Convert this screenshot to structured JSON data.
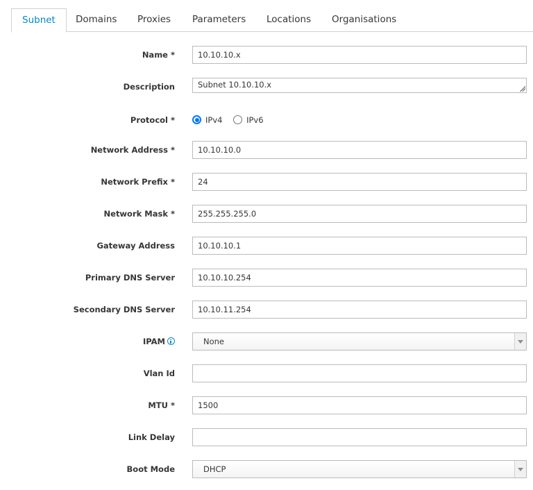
{
  "tabs": [
    {
      "label": "Subnet",
      "active": true
    },
    {
      "label": "Domains",
      "active": false
    },
    {
      "label": "Proxies",
      "active": false
    },
    {
      "label": "Parameters",
      "active": false
    },
    {
      "label": "Locations",
      "active": false
    },
    {
      "label": "Organisations",
      "active": false
    }
  ],
  "form": {
    "name": {
      "label": "Name *",
      "value": "10.10.10.x"
    },
    "description": {
      "label": "Description",
      "value": "Subnet 10.10.10.x"
    },
    "protocol": {
      "label": "Protocol *",
      "options": [
        "IPv4",
        "IPv6"
      ],
      "selected": "IPv4"
    },
    "network_address": {
      "label": "Network Address *",
      "value": "10.10.10.0"
    },
    "network_prefix": {
      "label": "Network Prefix *",
      "value": "24"
    },
    "network_mask": {
      "label": "Network Mask *",
      "value": "255.255.255.0"
    },
    "gateway_address": {
      "label": "Gateway Address",
      "value": "10.10.10.1"
    },
    "primary_dns": {
      "label": "Primary DNS Server",
      "value": "10.10.10.254"
    },
    "secondary_dns": {
      "label": "Secondary DNS Server",
      "value": "10.10.11.254"
    },
    "ipam": {
      "label": "IPAM",
      "value": "None",
      "info_icon": "info-circle-icon"
    },
    "vlan_id": {
      "label": "Vlan Id",
      "value": ""
    },
    "mtu": {
      "label": "MTU *",
      "value": "1500"
    },
    "link_delay": {
      "label": "Link Delay",
      "value": ""
    },
    "boot_mode": {
      "label": "Boot Mode",
      "value": "DHCP"
    }
  },
  "colors": {
    "accent": "#0088ce",
    "text": "#363636",
    "border": "#bbbbbb",
    "radio_checked": "#0075ff"
  }
}
